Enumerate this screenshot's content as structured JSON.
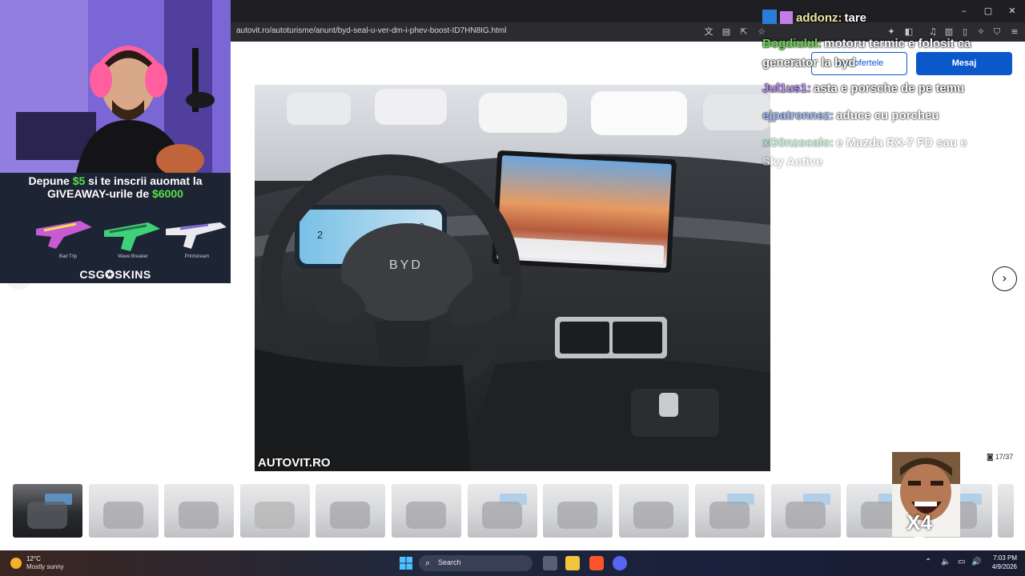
{
  "browser": {
    "url": "autovit.ro/autoturisme/anunt/byd-seal-u-ver-dm-i-phev-boost-ID7HN8IG.html",
    "window_controls": {
      "minimize": "–",
      "maximize": "▢",
      "close": "✕"
    }
  },
  "site": {
    "offers_button": "Vezi ofertele",
    "message_button": "Mesaj",
    "photo_watermark": "AUTOVIT.RO",
    "photo_counter": "17/37",
    "steering_logo": "BYD",
    "cluster_left": "2",
    "cluster_right": "0",
    "next_arrow": "›"
  },
  "promo": {
    "line1_pre": "Depune ",
    "line1_amount": "$5",
    "line1_post": " si te inscrii auomat la",
    "line2_pre": "GIVEAWAY-urile de ",
    "line2_amount": "$6000",
    "brand": "CSG✪SKINS",
    "skins": [
      "Bad Trip",
      "Wave Breaker",
      "Printstream"
    ]
  },
  "chat": [
    {
      "user": "addonz:",
      "message": "tare",
      "user_color": "#f4e6a3"
    },
    {
      "user": "Bogdiulul:",
      "message": "motoru termic e folosit ca",
      "user_color": "#6bd94a"
    },
    {
      "user": "",
      "message": "generator la byd",
      "user_color": "#ffffff"
    },
    {
      "user": "Jul1us1:",
      "message": "asta e porsche de pe temu",
      "user_color": "#b98cff"
    },
    {
      "user": "ejpatronnez:",
      "message": "aduce cu porcheu",
      "user_color": "#8fb3ff"
    },
    {
      "user": "xG0nzocalo:",
      "message": "e Mazda RX-7 FD sau e",
      "user_color": "#7ee0a0"
    },
    {
      "user": "",
      "message": "Sky Active",
      "user_color": "#ffffff"
    }
  ],
  "reaction": {
    "label": "X4"
  },
  "taskbar": {
    "weather_temp": "12°C",
    "weather_desc": "Mostly sunny",
    "search_label": "Search",
    "time": "7:03 PM",
    "date": "4/9/2026"
  },
  "colors": {
    "brand_blue": "#0a58ca",
    "money_green": "#58e04a"
  }
}
